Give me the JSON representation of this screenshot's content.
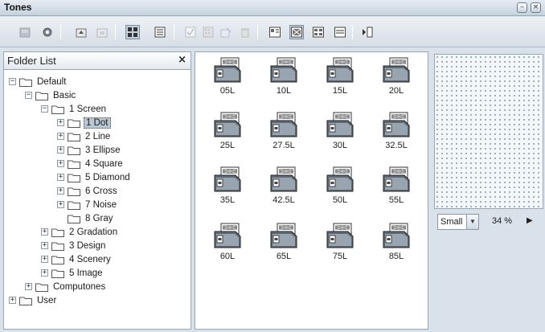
{
  "window": {
    "title": "Tones"
  },
  "icons": {
    "toolbar": [
      "tones-icon",
      "settings-icon",
      "folder-up-icon",
      "folder-icon",
      "large-icons-icon",
      "list-view-icon",
      "checkbox-icon",
      "pattern-icon",
      "rename-icon",
      "trash-icon",
      "tone-view-1-icon",
      "tone-view-2-icon",
      "tone-view-3-icon",
      "tone-view-4-icon",
      "insert-icon"
    ]
  },
  "folder_panel": {
    "title": "Folder List",
    "close_glyph": "×",
    "tree": [
      {
        "label": "Default",
        "expand": "−"
      },
      {
        "label": "Basic",
        "expand": "−"
      },
      {
        "label": "1 Screen",
        "expand": "−"
      },
      {
        "label": "1 Dot",
        "expand": "+"
      },
      {
        "label": "2 Line",
        "expand": "+"
      },
      {
        "label": "3 Ellipse",
        "expand": "+"
      },
      {
        "label": "4 Square",
        "expand": "+"
      },
      {
        "label": "5 Diamond",
        "expand": "+"
      },
      {
        "label": "6 Cross",
        "expand": "+"
      },
      {
        "label": "7 Noise",
        "expand": "+"
      },
      {
        "label": "8 Gray",
        "expand": ""
      },
      {
        "label": "2 Gradation",
        "expand": "+"
      },
      {
        "label": "3 Design",
        "expand": "+"
      },
      {
        "label": "4 Scenery",
        "expand": "+"
      },
      {
        "label": "5 Image",
        "expand": "+"
      },
      {
        "label": "Computones",
        "expand": "+"
      },
      {
        "label": "User",
        "expand": "+"
      }
    ]
  },
  "tones": [
    "05L",
    "10L",
    "15L",
    "20L",
    "25L",
    "27.5L",
    "30L",
    "32.5L",
    "35L",
    "42.5L",
    "50L",
    "55L",
    "60L",
    "65L",
    "75L",
    "85L"
  ],
  "preview": {
    "size_value": "Small",
    "zoom": "34 %"
  },
  "colors": {
    "accent": "#b9c6d3",
    "background": "#d9e2ea"
  }
}
